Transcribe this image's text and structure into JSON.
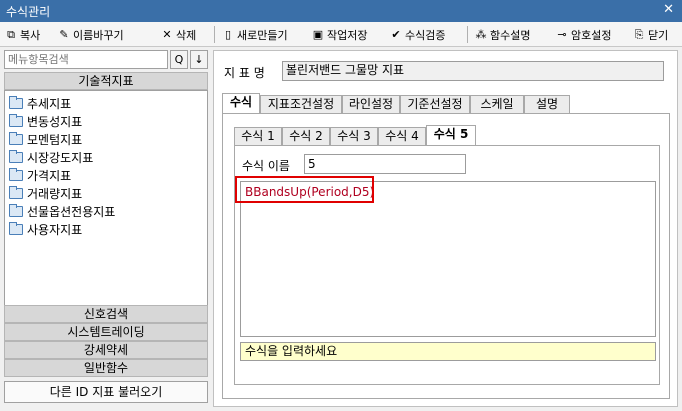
{
  "window": {
    "title": "수식관리",
    "close": "✕"
  },
  "toolbar": {
    "copy": "복사",
    "rename": "이름바꾸기",
    "delete": "삭제",
    "new": "새로만들기",
    "save": "작업저장",
    "verify": "수식검증",
    "func_desc": "함수설명",
    "password": "암호설정",
    "close": "닫기"
  },
  "left": {
    "search_placeholder": "메뉴항목검색",
    "search_icon": "Q",
    "down_icon": "↓",
    "section_title": "기술적지표",
    "tree_items": [
      "추세지표",
      "변동성지표",
      "모멘텀지표",
      "시장강도지표",
      "가격지표",
      "거래량지표",
      "선물옵션전용지표",
      "사용자지표"
    ],
    "bottom_sections": [
      "신호검색",
      "시스템트레이딩",
      "강세약세",
      "일반함수"
    ],
    "load_other": "다른 ID 지표 불러오기"
  },
  "right": {
    "indicator_label": "지 표 명",
    "indicator_name": "볼린저밴드 그물망 지표",
    "main_tabs": [
      "수식",
      "지표조건설정",
      "라인설정",
      "기준선설정",
      "스케일",
      "설명"
    ],
    "formula_tabs": [
      "수식 1",
      "수식 2",
      "수식 3",
      "수식 4",
      "수식 5"
    ],
    "formula_name_label": "수식 이름",
    "formula_name_value": "5",
    "formula_text": "BBandsUp(Period,D5)",
    "hint": "수식을 입력하세요"
  }
}
